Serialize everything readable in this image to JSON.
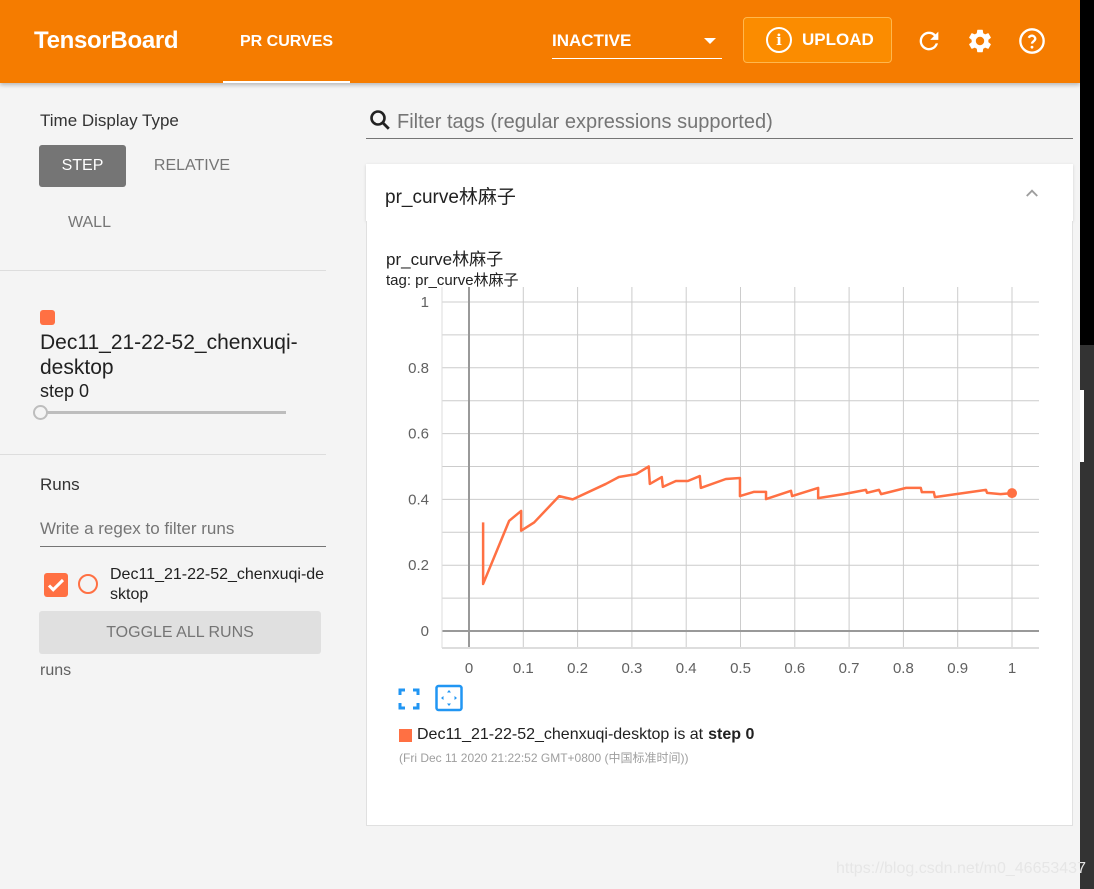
{
  "header": {
    "brand": "TensorBoard",
    "active_tab": "PR CURVES",
    "run_selector": "INACTIVE",
    "upload_label": "UPLOAD",
    "icons": [
      "info-icon",
      "refresh-icon",
      "settings-gear-icon",
      "help-icon"
    ]
  },
  "sidebar": {
    "time_display_title": "Time Display Type",
    "time_display_options": [
      {
        "label": "STEP",
        "active": true
      },
      {
        "label": "RELATIVE",
        "active": false
      },
      {
        "label": "WALL",
        "active": false
      }
    ],
    "run_card": {
      "name": "Dec11_21-22-52_chenxuqi-desktop",
      "step_label": "step 0",
      "step_slider_fraction": 0,
      "color": "#ff7043"
    },
    "runs_title": "Runs",
    "regex_placeholder": "Write a regex to filter runs",
    "runs": [
      {
        "label": "Dec11_21-22-52_chenxuqi-desktop",
        "checked": true,
        "color": "#ff7043"
      }
    ],
    "toggle_all_label": "TOGGLE ALL RUNS",
    "footer_label": "runs"
  },
  "main": {
    "filter_placeholder": "Filter tags (regular expressions supported)",
    "card_title": "pr_curve林麻子",
    "chart_title": "pr_curve林麻子",
    "chart_tag": "tag: pr_curve林麻子",
    "legend_run": "Dec11_21-22-52_chenxuqi-desktop",
    "legend_mid": "is at",
    "legend_step": "step 0",
    "legend_time": "(Fri Dec 11 2020 21:22:52 GMT+0800 (中国标准时间))"
  },
  "watermark": "https://blog.csdn.net/m0_46653437",
  "chart_data": {
    "type": "line",
    "title": "pr_curve林麻子",
    "subtitle": "tag: pr_curve林麻子",
    "xlabel": "",
    "ylabel": "",
    "xlim": [
      -0.05,
      1.05
    ],
    "ylim": [
      -0.05,
      1.05
    ],
    "x_ticks": [
      "0",
      "0.1",
      "0.2",
      "0.3",
      "0.4",
      "0.5",
      "0.6",
      "0.7",
      "0.8",
      "0.9",
      "1"
    ],
    "y_ticks": [
      "0",
      "0.2",
      "0.4",
      "0.6",
      "0.8",
      "1"
    ],
    "grid": true,
    "legend": "bottom-left",
    "series": [
      {
        "name": "Dec11_21-22-52_chenxuqi-desktop",
        "color": "#ff7043",
        "x": [
          0.026,
          0.026,
          0.074,
          0.096,
          0.096,
          0.12,
          0.166,
          0.191,
          0.252,
          0.276,
          0.308,
          0.331,
          0.333,
          0.355,
          0.357,
          0.381,
          0.403,
          0.425,
          0.427,
          0.473,
          0.499,
          0.499,
          0.525,
          0.547,
          0.547,
          0.593,
          0.595,
          0.643,
          0.643,
          0.69,
          0.731,
          0.733,
          0.755,
          0.759,
          0.805,
          0.832,
          0.834,
          0.856,
          0.858,
          0.952,
          0.954,
          0.979,
          1.0
        ],
        "y": [
          0.33,
          0.143,
          0.335,
          0.365,
          0.305,
          0.33,
          0.41,
          0.4,
          0.447,
          0.468,
          0.477,
          0.5,
          0.447,
          0.468,
          0.438,
          0.456,
          0.456,
          0.471,
          0.435,
          0.462,
          0.465,
          0.41,
          0.423,
          0.423,
          0.401,
          0.426,
          0.41,
          0.435,
          0.404,
          0.416,
          0.429,
          0.42,
          0.429,
          0.416,
          0.435,
          0.435,
          0.422,
          0.422,
          0.407,
          0.429,
          0.42,
          0.416,
          0.419
        ]
      }
    ]
  }
}
